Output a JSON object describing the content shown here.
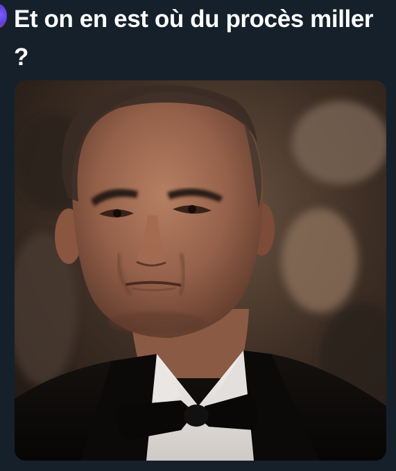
{
  "tweet": {
    "text": "Et on en est où du procès miller ?"
  },
  "media": {
    "alt": ""
  }
}
